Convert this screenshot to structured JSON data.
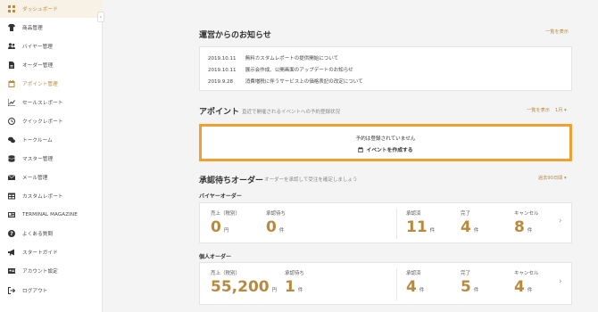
{
  "sidebar": {
    "items": [
      {
        "label": "ダッシュボード",
        "icon": "grid-icon",
        "active": true
      },
      {
        "label": "商品管理",
        "icon": "shirt-icon"
      },
      {
        "label": "バイヤー管理",
        "icon": "users-icon"
      },
      {
        "label": "オーダー管理",
        "icon": "document-icon"
      },
      {
        "label": "アポイント管理",
        "icon": "calendar-icon"
      },
      {
        "label": "セールスレポート",
        "icon": "chart-icon"
      },
      {
        "label": "クイックレポート",
        "icon": "clock-icon"
      },
      {
        "label": "トークルーム",
        "icon": "chat-icon"
      },
      {
        "label": "マスター管理",
        "icon": "database-icon"
      },
      {
        "label": "メール管理",
        "icon": "mail-icon"
      },
      {
        "label": "カスタムレポート",
        "icon": "table-icon"
      },
      {
        "label": "TERMINAL MAGAZINE",
        "icon": "magazine-icon"
      },
      {
        "label": "よくある質問",
        "icon": "question-icon"
      },
      {
        "label": "スタートガイド",
        "icon": "megaphone-icon"
      },
      {
        "label": "アカウント設定",
        "icon": "id-card-icon"
      },
      {
        "label": "ログアウト",
        "icon": "logout-icon"
      }
    ],
    "collapse_glyph": "‹"
  },
  "notices": {
    "title": "運営からのお知らせ",
    "view_all": "一覧を表示",
    "items": [
      {
        "date": "2019.10.11",
        "text": "無料カスタムレポートの提供開始について"
      },
      {
        "date": "2019.10.11",
        "text": "展示会作成、公開画面のアップデートのお知らせ"
      },
      {
        "date": "2019.9.28",
        "text": "消費増税に伴うサービス上の価格表記の改定について"
      }
    ]
  },
  "appointments": {
    "title": "アポイント",
    "subtitle": "直近で開催されるイベントへの予約登録状況",
    "view_all": "一覧を表示",
    "period": "1月 ▾",
    "empty_text": "予約は登録されていません",
    "create_label": "イベントを作成する"
  },
  "pending_orders": {
    "title": "承認待ちオーダー",
    "subtitle": "オーダーを承認して受注を確定しましょう",
    "period": "過去90日間 ▾",
    "groups": [
      {
        "name": "バイヤーオーダー",
        "sales_label": "売上（税別）",
        "sales_value": "0",
        "sales_unit": "円",
        "pending_label": "承認待ち",
        "pending_value": "0",
        "pending_unit": "件",
        "approved_label": "承認済",
        "approved_value": "11",
        "approved_unit": "件",
        "done_label": "完了",
        "done_value": "4",
        "done_unit": "件",
        "cancel_label": "キャンセル",
        "cancel_value": "8",
        "cancel_unit": "件"
      },
      {
        "name": "個人オーダー",
        "sales_label": "売上（税別）",
        "sales_value": "55,200",
        "sales_unit": "円",
        "pending_label": "承認待ち",
        "pending_value": "1",
        "pending_unit": "件",
        "approved_label": "承認済",
        "approved_value": "4",
        "approved_unit": "件",
        "done_label": "完了",
        "done_value": "5",
        "done_unit": "件",
        "cancel_label": "キャンセル",
        "cancel_value": "4",
        "cancel_unit": "件"
      }
    ],
    "chevron": "›"
  },
  "colors": {
    "accent": "#b88a3e",
    "highlight_border": "#f0a030",
    "active_bg": "#f7f1e6"
  }
}
